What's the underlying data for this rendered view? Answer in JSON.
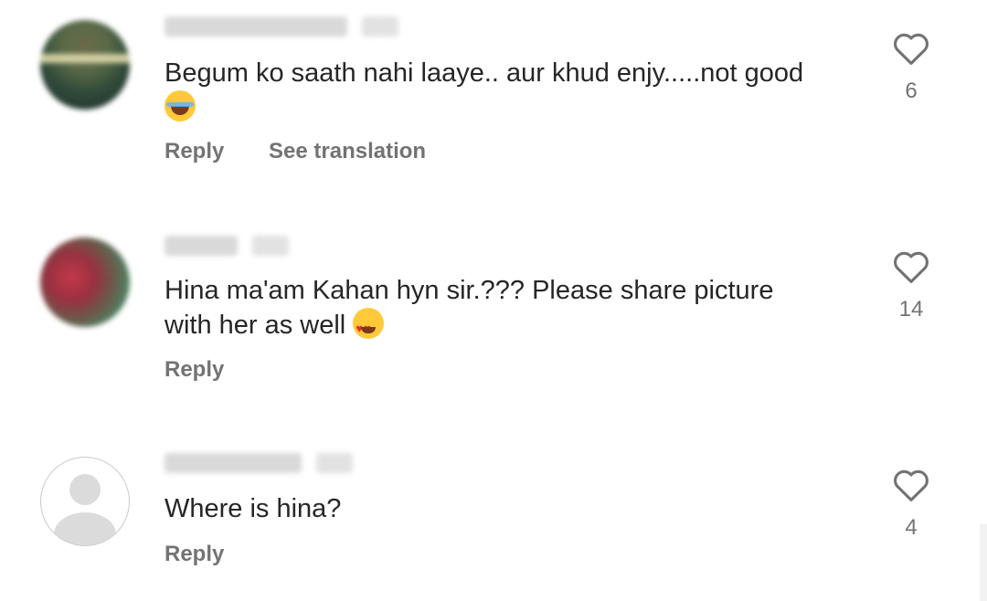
{
  "comments": [
    {
      "username": "",
      "timestamp": "",
      "text": "Begum ko saath nahi laaye.. aur khud enjy.....not good",
      "emoji": "rolling-on-floor-laughing",
      "actions": [
        "Reply",
        "See translation"
      ],
      "likes": "6"
    },
    {
      "username": "",
      "timestamp": "",
      "text": "Hina ma'am Kahan hyn sir.??? Please share picture with her as well",
      "emoji": "smiling-face-with-heart-eyes",
      "actions": [
        "Reply"
      ],
      "likes": "14"
    },
    {
      "username": "",
      "timestamp": "",
      "text": "Where is hina?",
      "emoji": "",
      "actions": [
        "Reply"
      ],
      "likes": "4"
    }
  ],
  "icons": {
    "like": "heart-outline-icon",
    "default_avatar": "default-avatar-icon"
  },
  "colors": {
    "text": "#262626",
    "secondary": "#737373",
    "background": "#ffffff"
  }
}
